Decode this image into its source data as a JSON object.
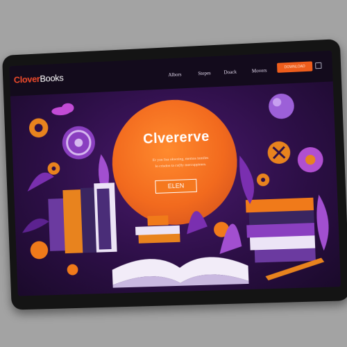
{
  "brand": {
    "part1": "Clover",
    "part2": "Books"
  },
  "nav": {
    "links": [
      "Albors",
      "Stepes",
      "Doack",
      "Movers"
    ],
    "cta_label": "DOWNLOAD"
  },
  "hero": {
    "title": "Clvererve",
    "subtitle_line1": "Er yon lisa okwning, memos inmiles",
    "subtitle_line2": "lo crisdon ta cu(lly mercuppimes.",
    "button_label": "ELEN"
  },
  "colors": {
    "accent": "#ef4b2b",
    "orange": "#f26a1e",
    "purple": "#2d0f47",
    "nav_bg": "#130b1c"
  },
  "icons": [
    "menu-icon",
    "gear-icon",
    "book-icon",
    "apple-icon",
    "moon-icon"
  ]
}
